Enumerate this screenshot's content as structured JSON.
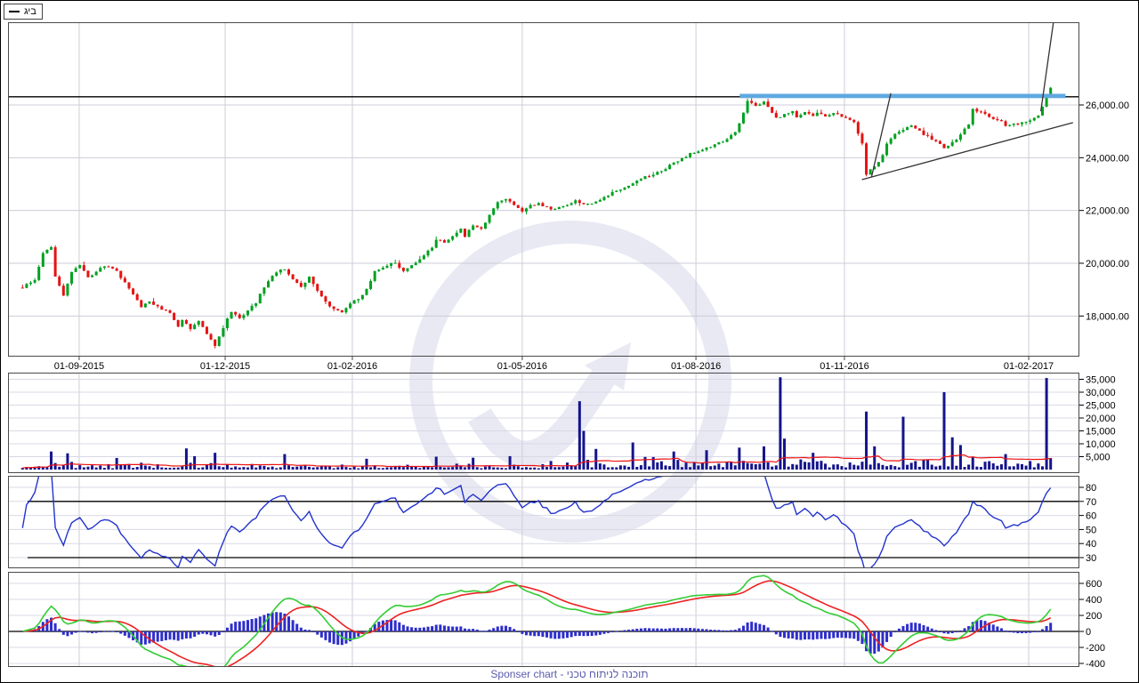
{
  "legend": {
    "symbol": "ביג"
  },
  "footer": {
    "text": "Sponser chart - תוכנה לניתוח טכני"
  },
  "colors": {
    "up": "#00a020",
    "down": "#e51212",
    "volume_bar": "#14148c",
    "volume_ma": "#ee1111",
    "rsi_line": "#2233cc",
    "macd_hist": "#2e2ecc",
    "macd_line": "#33cc33",
    "macd_signal": "#ee2222",
    "resistance_blue": "#5fa8e0",
    "trendline": "#333333",
    "grid": "#ccccd8",
    "grid_light": "#d9d9e7",
    "border": "#4a4a4a",
    "watermark": "#e9e9f4",
    "axis_text": "#000000",
    "footer_text": "#5b5bad"
  },
  "chart_data": [
    {
      "id": "price",
      "type": "candlestick",
      "title": "ביג",
      "candle_count": 252,
      "x_axis": {
        "ticks": [
          {
            "label": "01-09-2015",
            "frac": 0.0664
          },
          {
            "label": "01-12-2015",
            "frac": 0.2027
          },
          {
            "label": "01-02-2016",
            "frac": 0.3214
          },
          {
            "label": "01-05-2016",
            "frac": 0.48
          },
          {
            "label": "01-08-2016",
            "frac": 0.6421
          },
          {
            "label": "01-11-2016",
            "frac": 0.7807
          },
          {
            "label": "01-02-2017",
            "frac": 0.9527
          }
        ]
      },
      "y_axis": {
        "ticks": [
          {
            "label": "26,000.00",
            "value": 26000
          },
          {
            "label": "24,000.00",
            "value": 24000
          },
          {
            "label": "22,000.00",
            "value": 22000
          },
          {
            "label": "20,000.00",
            "value": 20000
          },
          {
            "label": "18,000.00",
            "value": 18000
          }
        ],
        "visible_range": [
          16500,
          29200
        ]
      },
      "close_keypoints": [
        [
          0.014,
          19100
        ],
        [
          0.025,
          19350
        ],
        [
          0.033,
          20420
        ],
        [
          0.04,
          20600
        ],
        [
          0.045,
          19520
        ],
        [
          0.05,
          18790
        ],
        [
          0.058,
          19680
        ],
        [
          0.066,
          19920
        ],
        [
          0.075,
          19450
        ],
        [
          0.083,
          19680
        ],
        [
          0.091,
          19920
        ],
        [
          0.1,
          19680
        ],
        [
          0.108,
          19250
        ],
        [
          0.116,
          18840
        ],
        [
          0.125,
          18340
        ],
        [
          0.133,
          18570
        ],
        [
          0.141,
          18340
        ],
        [
          0.15,
          18100
        ],
        [
          0.158,
          17570
        ],
        [
          0.164,
          17830
        ],
        [
          0.169,
          17500
        ],
        [
          0.178,
          17770
        ],
        [
          0.186,
          17330
        ],
        [
          0.194,
          16900
        ],
        [
          0.201,
          17570
        ],
        [
          0.208,
          18170
        ],
        [
          0.216,
          17900
        ],
        [
          0.224,
          18240
        ],
        [
          0.233,
          18510
        ],
        [
          0.241,
          19110
        ],
        [
          0.249,
          19680
        ],
        [
          0.257,
          19780
        ],
        [
          0.266,
          19350
        ],
        [
          0.274,
          19110
        ],
        [
          0.28,
          19450
        ],
        [
          0.286,
          19180
        ],
        [
          0.294,
          18780
        ],
        [
          0.302,
          18340
        ],
        [
          0.311,
          18170
        ],
        [
          0.319,
          18440
        ],
        [
          0.327,
          18670
        ],
        [
          0.336,
          19010
        ],
        [
          0.344,
          19680
        ],
        [
          0.352,
          19920
        ],
        [
          0.36,
          20020
        ],
        [
          0.369,
          19680
        ],
        [
          0.377,
          19920
        ],
        [
          0.385,
          20120
        ],
        [
          0.394,
          20600
        ],
        [
          0.4,
          20930
        ],
        [
          0.407,
          20800
        ],
        [
          0.415,
          21030
        ],
        [
          0.421,
          21270
        ],
        [
          0.427,
          21030
        ],
        [
          0.435,
          21470
        ],
        [
          0.443,
          21270
        ],
        [
          0.45,
          21870
        ],
        [
          0.457,
          22270
        ],
        [
          0.463,
          22470
        ],
        [
          0.472,
          22200
        ],
        [
          0.48,
          22000
        ],
        [
          0.488,
          22200
        ],
        [
          0.497,
          22270
        ],
        [
          0.505,
          22030
        ],
        [
          0.513,
          22140
        ],
        [
          0.522,
          22200
        ],
        [
          0.53,
          22400
        ],
        [
          0.538,
          22200
        ],
        [
          0.547,
          22330
        ],
        [
          0.555,
          22530
        ],
        [
          0.563,
          22670
        ],
        [
          0.571,
          22800
        ],
        [
          0.58,
          22940
        ],
        [
          0.588,
          23100
        ],
        [
          0.596,
          23270
        ],
        [
          0.605,
          23440
        ],
        [
          0.613,
          23600
        ],
        [
          0.621,
          23810
        ],
        [
          0.63,
          23940
        ],
        [
          0.638,
          24140
        ],
        [
          0.646,
          24280
        ],
        [
          0.654,
          24380
        ],
        [
          0.663,
          24550
        ],
        [
          0.671,
          24710
        ],
        [
          0.679,
          24950
        ],
        [
          0.685,
          25730
        ],
        [
          0.691,
          26130
        ],
        [
          0.698,
          25970
        ],
        [
          0.704,
          26130
        ],
        [
          0.711,
          25900
        ],
        [
          0.718,
          25490
        ],
        [
          0.724,
          25630
        ],
        [
          0.731,
          25760
        ],
        [
          0.738,
          25560
        ],
        [
          0.744,
          25700
        ],
        [
          0.751,
          25560
        ],
        [
          0.757,
          25700
        ],
        [
          0.764,
          25560
        ],
        [
          0.771,
          25660
        ],
        [
          0.777,
          25560
        ],
        [
          0.784,
          25460
        ],
        [
          0.79,
          25360
        ],
        [
          0.797,
          24550
        ],
        [
          0.801,
          23340
        ],
        [
          0.806,
          23540
        ],
        [
          0.811,
          23870
        ],
        [
          0.816,
          24140
        ],
        [
          0.822,
          24550
        ],
        [
          0.829,
          24890
        ],
        [
          0.835,
          25090
        ],
        [
          0.842,
          25220
        ],
        [
          0.849,
          25050
        ],
        [
          0.856,
          24890
        ],
        [
          0.862,
          24690
        ],
        [
          0.869,
          24490
        ],
        [
          0.875,
          24350
        ],
        [
          0.882,
          24550
        ],
        [
          0.889,
          24890
        ],
        [
          0.895,
          25290
        ],
        [
          0.9,
          25830
        ],
        [
          0.907,
          25700
        ],
        [
          0.914,
          25560
        ],
        [
          0.92,
          25460
        ],
        [
          0.927,
          25360
        ],
        [
          0.933,
          25220
        ],
        [
          0.94,
          25290
        ],
        [
          0.947,
          25320
        ],
        [
          0.953,
          25430
        ],
        [
          0.96,
          25630
        ],
        [
          0.965,
          25970
        ],
        [
          0.969,
          26300
        ],
        [
          0.972,
          26640
        ]
      ],
      "overlays": {
        "horizontal_line_price": 26310,
        "blue_band": {
          "x1_frac": 0.683,
          "x2_frac": 0.987,
          "price": 26340
        },
        "trendlines": [
          {
            "x1_frac": 0.797,
            "price1": 23170,
            "x2_frac": 0.994,
            "price2": 25330
          },
          {
            "x1_frac": 0.806,
            "price1": 23270,
            "x2_frac": 0.824,
            "price2": 26440
          },
          {
            "x1_frac": 0.964,
            "price1": 25760,
            "x2_frac": 0.976,
            "price2": 29200
          }
        ]
      }
    },
    {
      "id": "volume",
      "type": "bar",
      "title": "Volume",
      "y_axis": {
        "ticks": [
          {
            "label": "35,000",
            "value": 35000
          },
          {
            "label": "30,000",
            "value": 30000
          },
          {
            "label": "25,000",
            "value": 25000
          },
          {
            "label": "20,000",
            "value": 20000
          },
          {
            "label": "15,000",
            "value": 15000
          },
          {
            "label": "10,000",
            "value": 10000
          },
          {
            "label": "5,000",
            "value": 5000
          }
        ]
      },
      "base_range": [
        400,
        3000
      ],
      "ma_period": 25,
      "spikes": [
        [
          0.04,
          7000
        ],
        [
          0.055,
          6300
        ],
        [
          0.1,
          4500
        ],
        [
          0.168,
          8200
        ],
        [
          0.176,
          5200
        ],
        [
          0.194,
          6500
        ],
        [
          0.26,
          6000
        ],
        [
          0.336,
          4200
        ],
        [
          0.4,
          5000
        ],
        [
          0.436,
          4600
        ],
        [
          0.47,
          5200
        ],
        [
          0.533,
          26500
        ],
        [
          0.538,
          15000
        ],
        [
          0.548,
          8000
        ],
        [
          0.582,
          10500
        ],
        [
          0.62,
          7000
        ],
        [
          0.652,
          7500
        ],
        [
          0.682,
          8500
        ],
        [
          0.706,
          9000
        ],
        [
          0.72,
          35800
        ],
        [
          0.726,
          12000
        ],
        [
          0.752,
          6500
        ],
        [
          0.803,
          22500
        ],
        [
          0.81,
          9000
        ],
        [
          0.836,
          20500
        ],
        [
          0.874,
          30000
        ],
        [
          0.88,
          12500
        ],
        [
          0.888,
          9500
        ],
        [
          0.93,
          6000
        ],
        [
          0.968,
          35500
        ]
      ]
    },
    {
      "id": "rsi",
      "type": "line",
      "title": "RSI",
      "period": 14,
      "levels": [
        70,
        30
      ],
      "y_axis": {
        "ticks": [
          {
            "label": "80",
            "value": 80
          },
          {
            "label": "70",
            "value": 70
          },
          {
            "label": "60",
            "value": 60
          },
          {
            "label": "50",
            "value": 50
          },
          {
            "label": "40",
            "value": 40
          },
          {
            "label": "30",
            "value": 30
          }
        ]
      }
    },
    {
      "id": "macd",
      "type": "macd",
      "title": "MACD",
      "fast": 12,
      "slow": 26,
      "signal": 9,
      "y_axis": {
        "ticks": [
          {
            "label": "600",
            "value": 600
          },
          {
            "label": "400",
            "value": 400
          },
          {
            "label": "200",
            "value": 200
          },
          {
            "label": "0",
            "value": 0
          },
          {
            "label": "-200",
            "value": -200
          },
          {
            "label": "-400",
            "value": -400
          }
        ]
      }
    }
  ]
}
